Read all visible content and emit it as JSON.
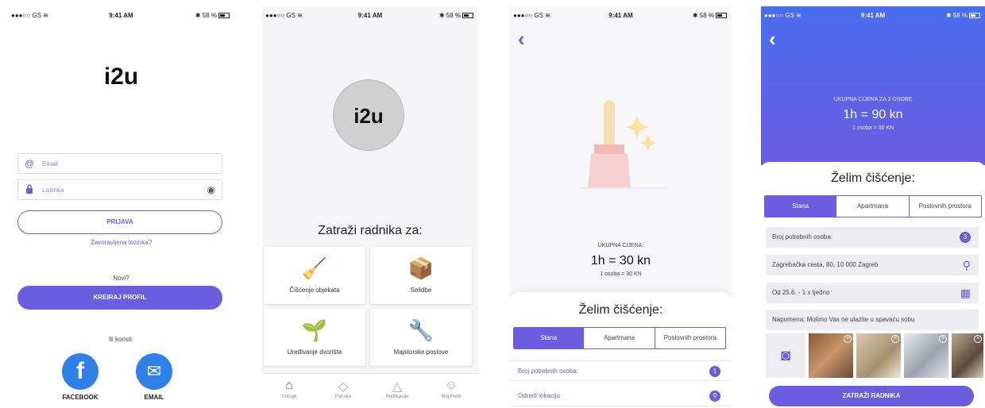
{
  "status_bar": {
    "carrier": "●●●○○ GS ≋",
    "time": "9:41 AM",
    "battery": "✱ 58 %"
  },
  "login": {
    "logo": "i2u",
    "email_placeholder": "Email",
    "password_placeholder": "Lozinka",
    "login_button": "PRIJAVA",
    "forgot_password": "Zavoravljena lozinka?",
    "new_prompt": "Novi?",
    "create_profile_button": "KREIRAJ PROFIL",
    "or_use": "Ili koristi:",
    "facebook_label": "FACEBOOK",
    "email_label": "EMAIL"
  },
  "home": {
    "logo": "i2u",
    "title": "Zatraži radnika za:",
    "services": [
      {
        "label": "Čišćenje objekata",
        "icon": "broom-icon"
      },
      {
        "label": "Selidbe",
        "icon": "movers-icon"
      },
      {
        "label": "Uređivanje dvorišta",
        "icon": "plant-icon"
      },
      {
        "label": "Majstorske poslove",
        "icon": "tools-icon"
      }
    ],
    "tabs": [
      {
        "label": "Usluge",
        "icon": "home-icon"
      },
      {
        "label": "Ponuke",
        "icon": "offers-icon"
      },
      {
        "label": "Notifikacije",
        "icon": "bell-icon"
      },
      {
        "label": "Moj Profil",
        "icon": "profile-icon"
      }
    ]
  },
  "cleaning": {
    "price_caption": "UKUPNA CIJENA:",
    "price": "1h = 30 kn",
    "per_person": "1 osoba = 30 KN",
    "sheet_title": "Želim čišćenje:",
    "options": [
      "Stana",
      "Apartmana",
      "Poslovnih prostora"
    ],
    "rows": [
      {
        "label": "Broj potrebnih osoba:",
        "badge": "1"
      },
      {
        "label": "Odredi lokaciju",
        "badge": "⚲"
      }
    ]
  },
  "cleaning_detail": {
    "price_caption": "UKUPNA CIJENA ZA 3 OSOBE",
    "price": "1h = 90 kn",
    "per_person": "1 osoba = 30 KN",
    "sheet_title": "Želim čišćenje:",
    "options": [
      "Stana",
      "Apartmana",
      "Poslovnih prostora"
    ],
    "persons_label": "Broj potrebnih osoba:",
    "persons_value": "3",
    "address": "Zagrebačka cesta, 80, 10 000 Zagreb",
    "schedule": "Od 25.6. - 1 x tjedno",
    "note": "Napomena: Molimo Vas ne ulazite u spavaću sobu",
    "request_button": "ZATRAŽI RADNIKA"
  },
  "colors": {
    "accent": "#6b5ce0",
    "facebook": "#2f80e8",
    "hero_top": "#4a6df0"
  }
}
